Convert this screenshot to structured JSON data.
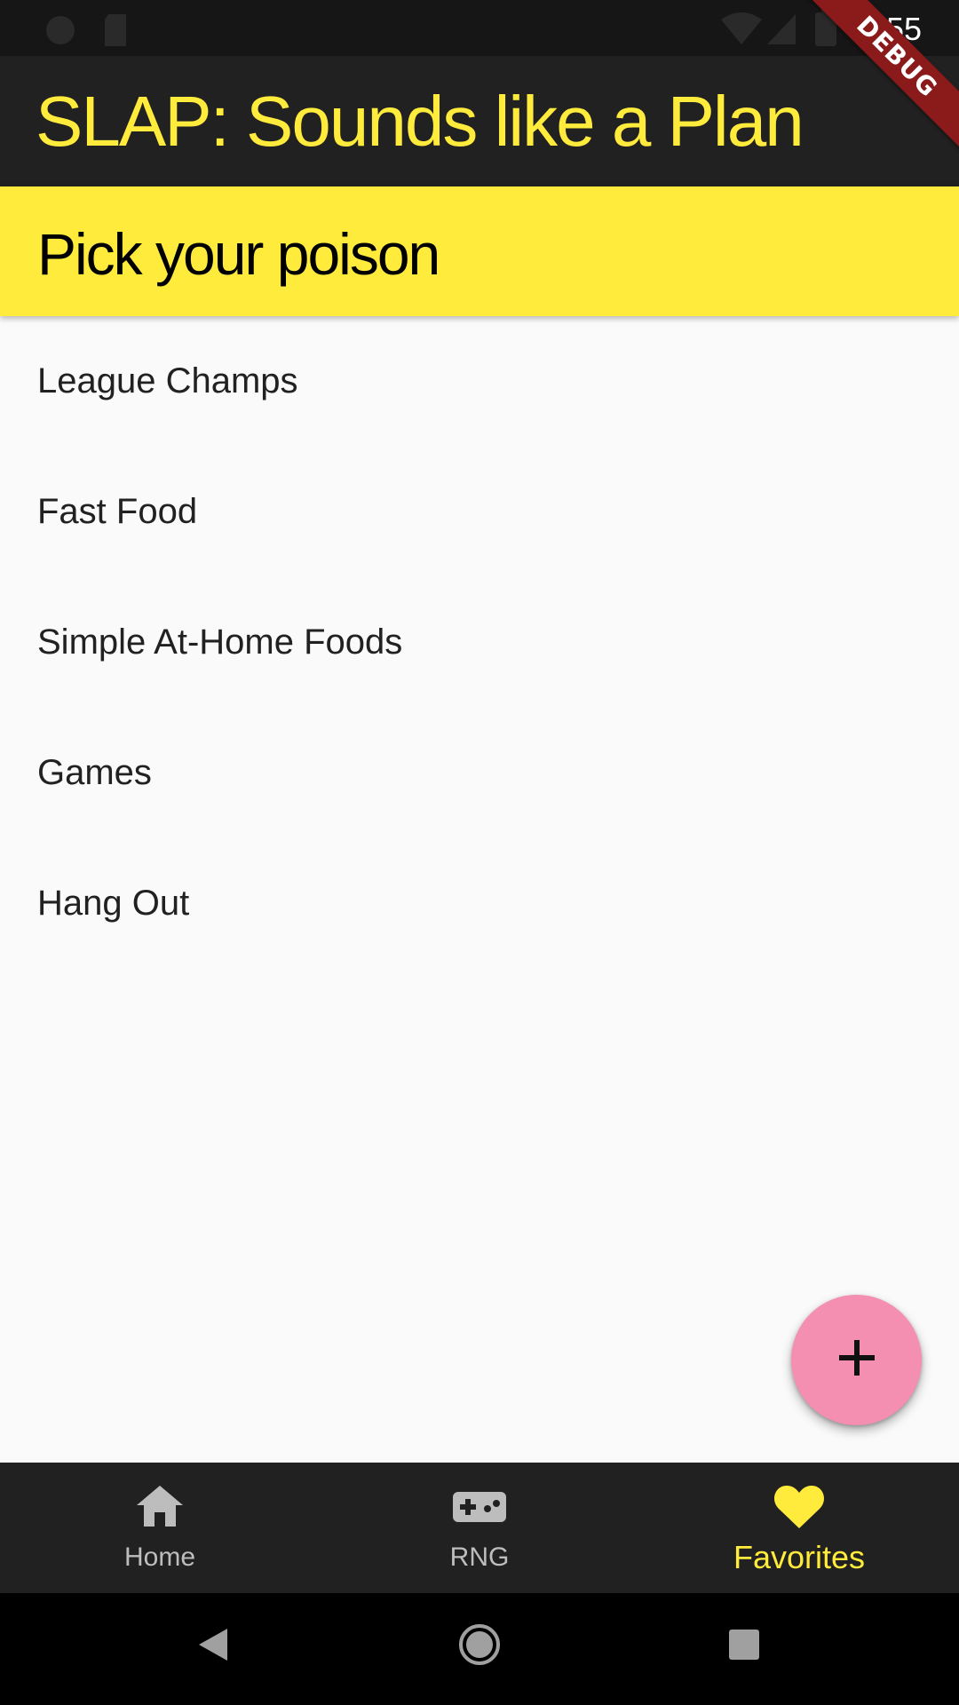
{
  "status_bar": {
    "time": "8:55",
    "icons": [
      "circle-status-icon",
      "sd-card-icon",
      "wifi-icon",
      "cell-signal-icon",
      "battery-icon"
    ]
  },
  "app_bar": {
    "title": "SLAP: Sounds like a Plan"
  },
  "debug_banner": {
    "label": "DEBUG"
  },
  "section": {
    "title": "Pick your poison"
  },
  "list": {
    "items": [
      {
        "label": "League Champs"
      },
      {
        "label": "Fast Food"
      },
      {
        "label": "Simple At-Home Foods"
      },
      {
        "label": "Games"
      },
      {
        "label": "Hang Out"
      }
    ]
  },
  "fab": {
    "icon": "plus-icon"
  },
  "bottom_nav": {
    "items": [
      {
        "label": "Home",
        "icon": "home-icon",
        "active": false
      },
      {
        "label": "RNG",
        "icon": "gamepad-icon",
        "active": false
      },
      {
        "label": "Favorites",
        "icon": "heart-icon",
        "active": true
      }
    ]
  },
  "colors": {
    "primary": "#212121",
    "accent": "#ffeb3b",
    "fab": "#f48fb1",
    "debug": "#8b1a1a",
    "background": "#fafafa"
  }
}
